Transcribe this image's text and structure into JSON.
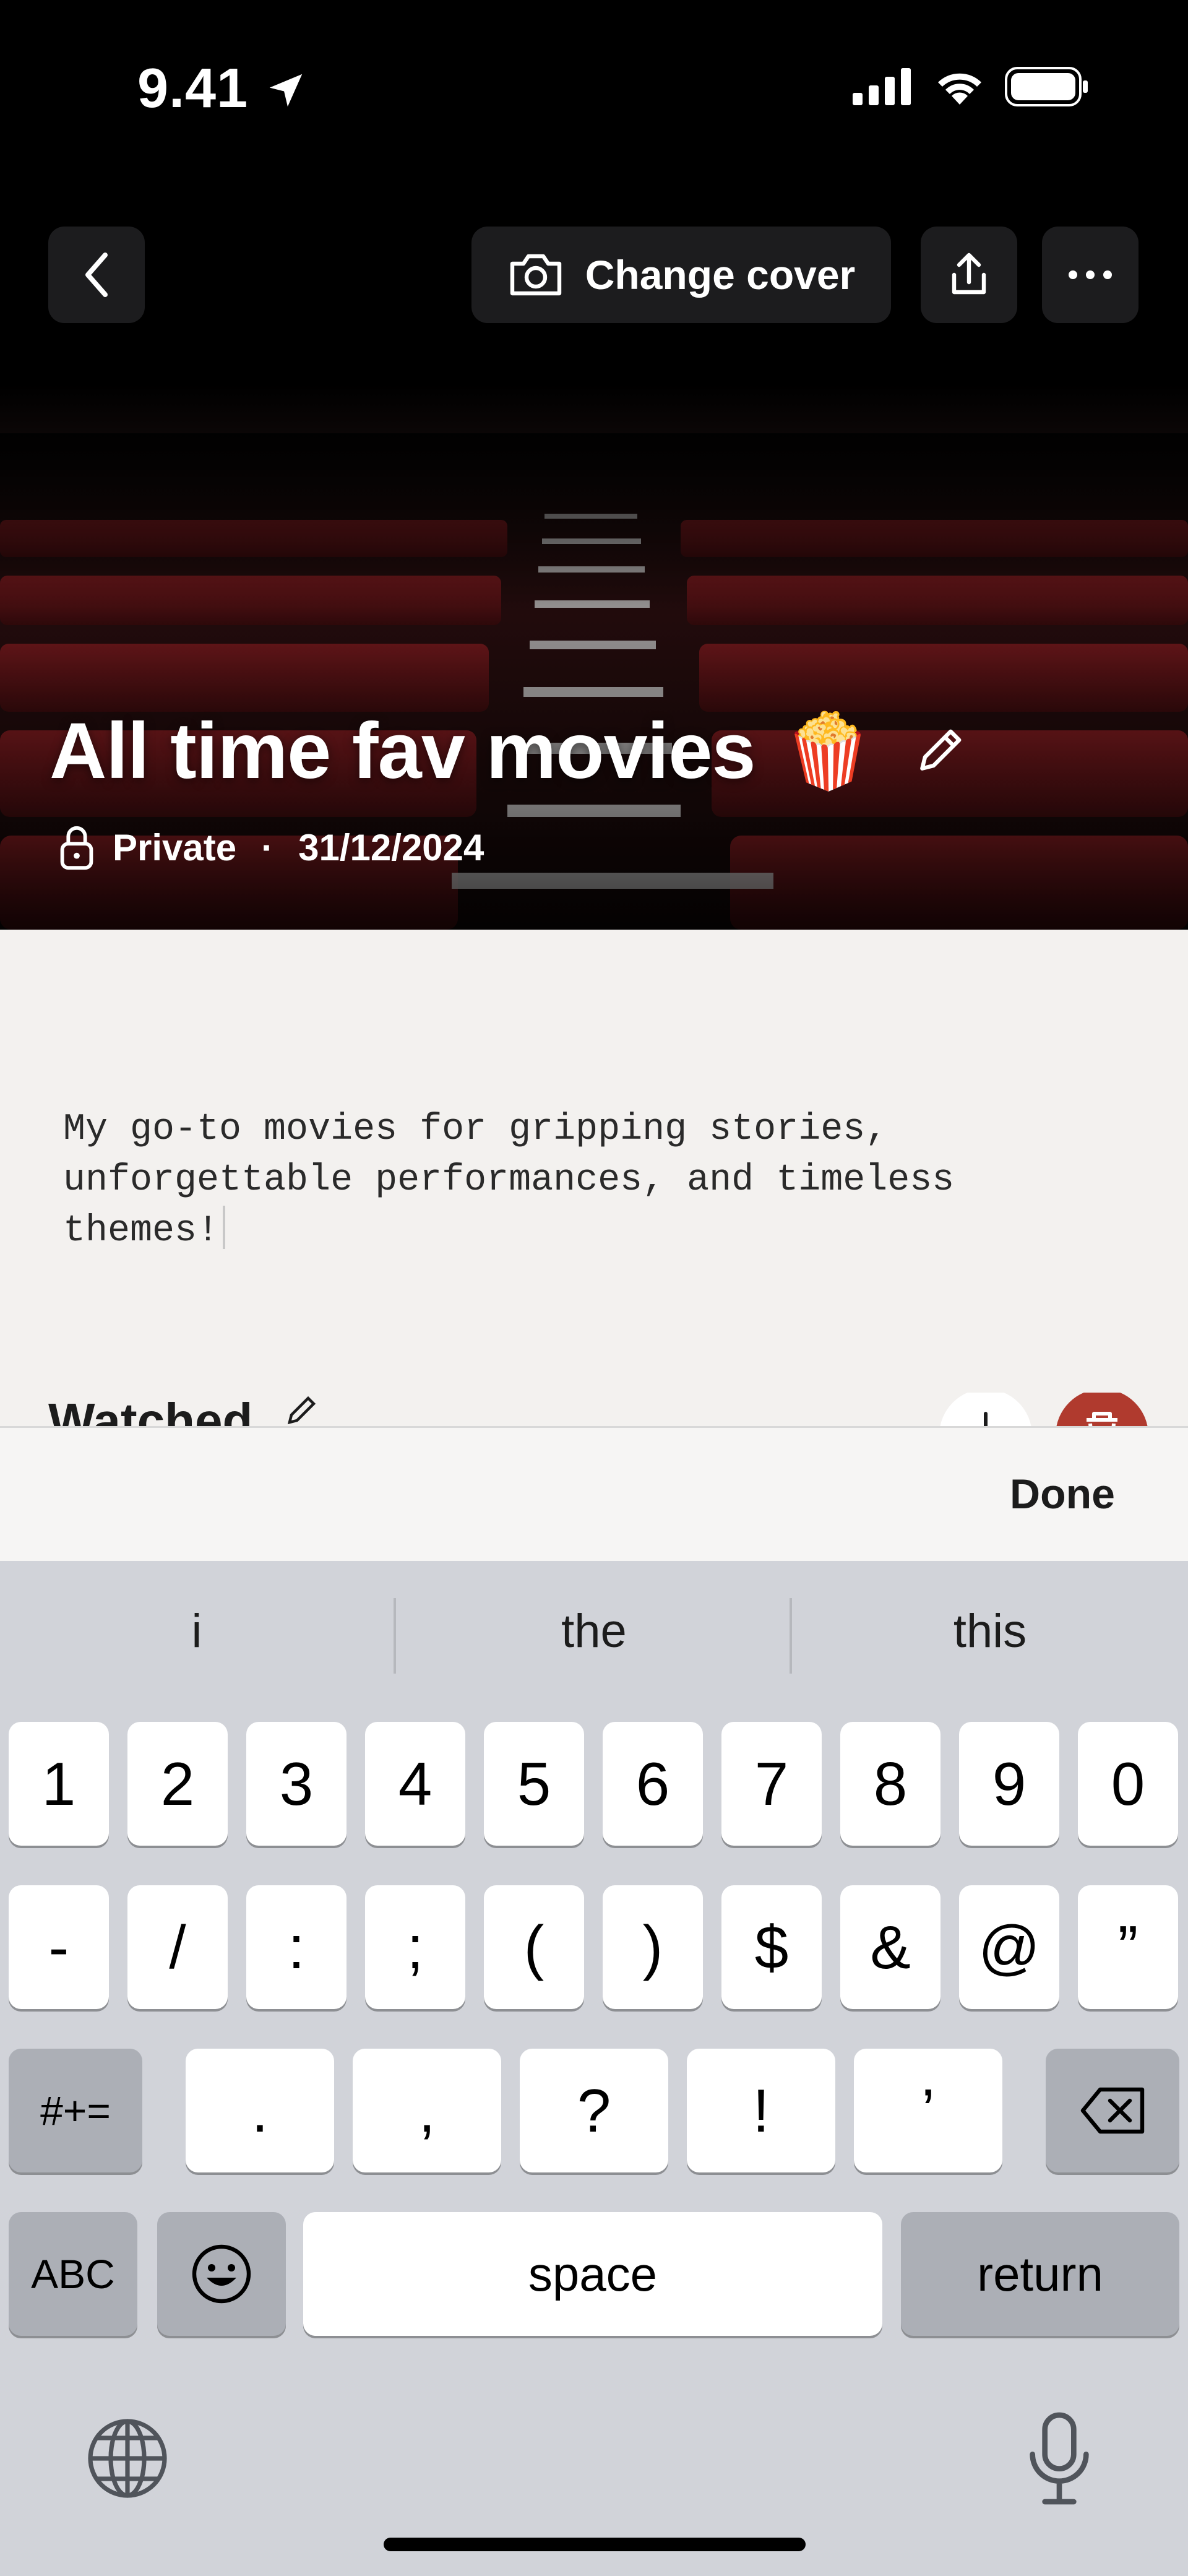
{
  "status_bar": {
    "time": "9.41"
  },
  "header": {
    "change_cover_label": "Change cover",
    "title": "All time fav movies",
    "title_emoji": "🍿",
    "privacy": "Private",
    "separator": "·",
    "date": "31/12/2024"
  },
  "content": {
    "description": "My go-to movies for gripping stories,\nunforgettable performances, and timeless\nthemes!",
    "section_title": "Watched"
  },
  "accessory": {
    "done_label": "Done"
  },
  "keyboard": {
    "suggestions": [
      "i",
      "the",
      "this"
    ],
    "row1": [
      "1",
      "2",
      "3",
      "4",
      "5",
      "6",
      "7",
      "8",
      "9",
      "0"
    ],
    "row2": [
      "-",
      "/",
      ":",
      ";",
      "(",
      ")",
      "$",
      "&",
      "@",
      "”"
    ],
    "row3": {
      "mode": "#+=",
      "keys": [
        ".",
        ",",
        "?",
        "!",
        "’"
      ]
    },
    "row4": {
      "abc": "ABC",
      "space": "space",
      "return": "return"
    }
  },
  "colors": {
    "delete_button": "#b03a2e",
    "keyboard_bg": "#d1d3d9",
    "header_btn": "#1c1c1e"
  },
  "icons": [
    "location-arrow-icon",
    "signal-icon",
    "wifi-icon",
    "battery-icon",
    "back-chevron-icon",
    "camera-icon",
    "share-icon",
    "more-icon",
    "pencil-icon",
    "lock-icon",
    "plus-icon",
    "trash-icon",
    "delete-key-icon",
    "emoji-icon",
    "globe-icon",
    "microphone-icon"
  ]
}
